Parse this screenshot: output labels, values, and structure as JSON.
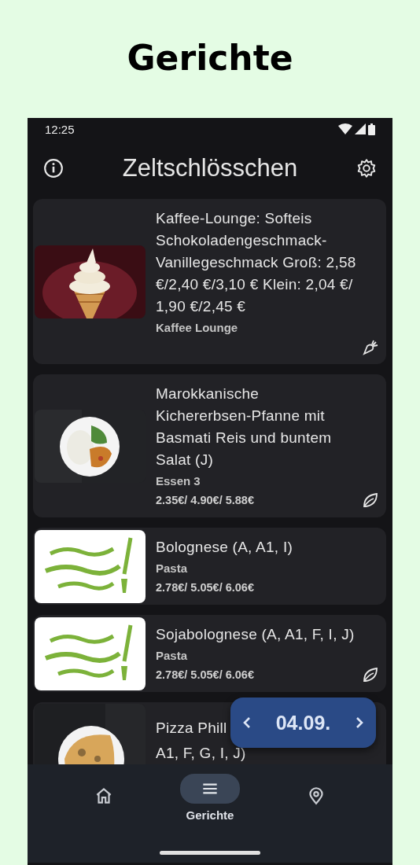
{
  "page_title": "Gerichte",
  "status_bar": {
    "time": "12:25"
  },
  "app_bar": {
    "title": "Zeltschlösschen"
  },
  "dishes": [
    {
      "image": {
        "kind": "picture"
      },
      "title": [
        "Kaffee-Lounge: Softeis Schokoladengeschmack-Vanillegeschmack Groß: 2,58 €/2,40 €/3,10 € Klein: 2,04 €/ 1,90 €/2,45 €"
      ],
      "category": "Kaffee Lounge",
      "diet": {
        "kind": "vegetarian"
      }
    },
    {
      "image": {
        "kind": "picture"
      },
      "title": [
        "Marokkanische Kichererbsen-Pfanne mit Basmati Reis und buntem Salat (J)"
      ],
      "category": "Essen 3",
      "prices": "2.35€/ 4.90€/ 5.88€",
      "diet": {
        "kind": "vegan"
      }
    },
    {
      "image": {
        "kind": "picture"
      },
      "title": [
        "Bolognese (A, A1, I)"
      ],
      "category": "Pasta",
      "prices": "2.78€/ 5.05€/ 6.06€"
    },
    {
      "image": {
        "kind": "picture"
      },
      "title": [
        "Sojabolognese (A, A1, F, I, J)"
      ],
      "category": "Pasta",
      "prices": "2.78€/ 5.05€/ 6.06€",
      "diet": {
        "kind": "vegan"
      }
    },
    {
      "image": {
        "kind": "picture"
      },
      "title": [
        "Pizza Phill",
        "A1, F, G, I, J)"
      ]
    }
  ],
  "date_picker": {
    "date": "04.09."
  },
  "nav": [
    {
      "selected": false
    },
    {
      "label": "Gerichte",
      "selected": true
    },
    {
      "selected": false
    }
  ]
}
